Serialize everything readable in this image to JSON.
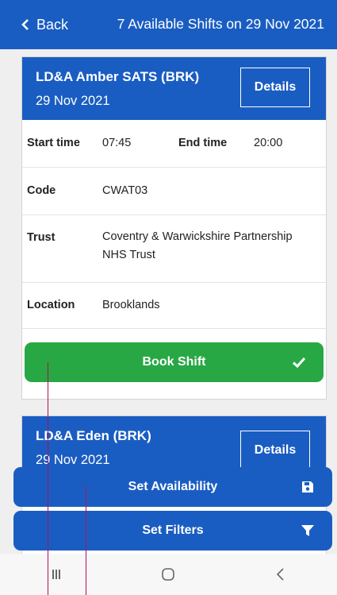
{
  "header": {
    "back_label": "Back",
    "title": "7 Available Shifts on 29 Nov 2021"
  },
  "shifts": [
    {
      "name": "LD&A Amber SATS (BRK)",
      "date": "29 Nov 2021",
      "details_label": "Details",
      "start_label": "Start time",
      "start_value": "07:45",
      "end_label": "End time",
      "end_value": "20:00",
      "code_label": "Code",
      "code_value": "CWAT03",
      "trust_label": "Trust",
      "trust_value": "Coventry & Warwickshire Partnership NHS Trust",
      "location_label": "Location",
      "location_value": "Brooklands",
      "book_label": "Book Shift"
    },
    {
      "name": "LD&A Eden (BRK)",
      "date": "29 Nov 2021",
      "details_label": "Details"
    }
  ],
  "actions": {
    "availability_label": "Set Availability",
    "filters_label": "Set Filters"
  },
  "colors": {
    "primary": "#1a5dc2",
    "success": "#28a745"
  },
  "icons": {
    "back": "chevron-left-icon",
    "book": "check-icon",
    "availability": "save-icon",
    "filters": "filter-icon",
    "nav": [
      "recent-apps-icon",
      "home-icon",
      "nav-back-icon"
    ]
  }
}
